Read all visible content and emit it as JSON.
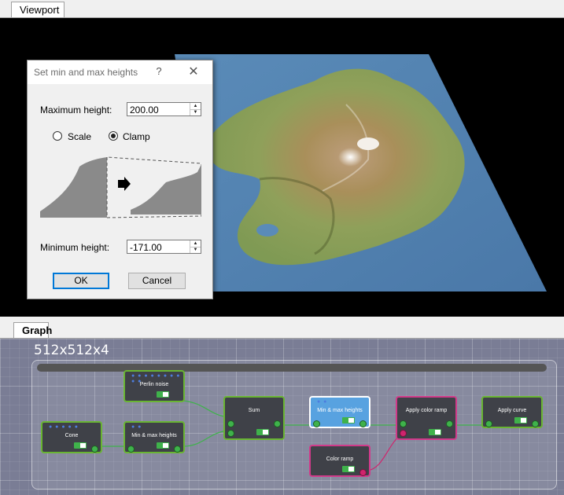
{
  "viewport_tab": "Viewport",
  "graph_tab": "Graph",
  "dialog": {
    "title": "Set min and max heights",
    "help": "?",
    "close": "✕",
    "max_label": "Maximum height:",
    "max_value": "200.00",
    "scale_label": "Scale",
    "clamp_label": "Clamp",
    "min_label": "Minimum height:",
    "min_value": "-171.00",
    "ok": "OK",
    "cancel": "Cancel"
  },
  "graph": {
    "resolution": "512x512x4",
    "nodes": {
      "cone": "Cone",
      "perlin": "Perlin noise",
      "minmax1": "Min & max heights",
      "sum": "Sum",
      "minmax2": "Min & max heights",
      "color_ramp": "Color ramp",
      "apply_ramp": "Apply color ramp",
      "apply_curve": "Apply curve"
    }
  }
}
